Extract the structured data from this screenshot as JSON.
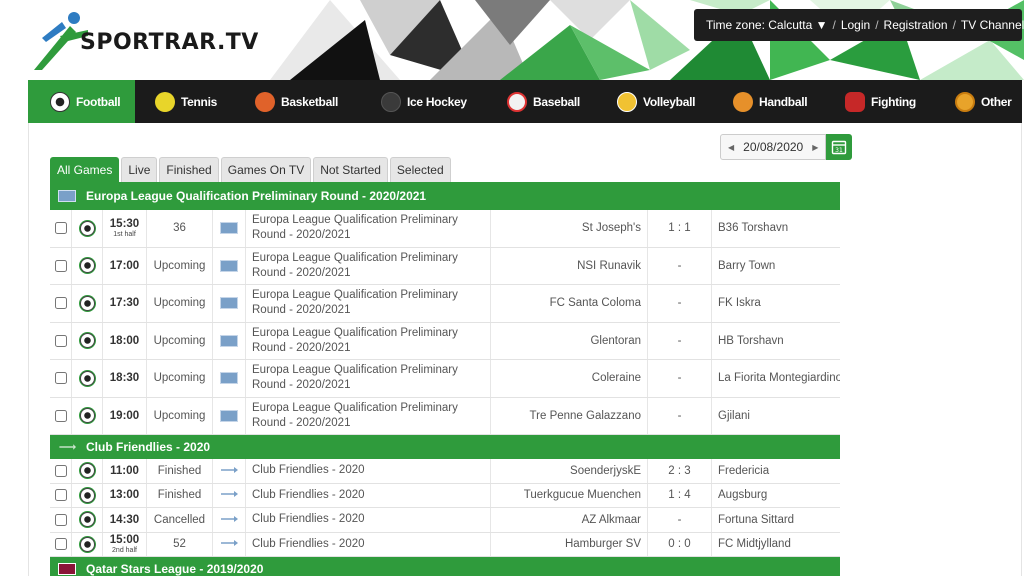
{
  "header": {
    "logo_text": "SPORTRAR.TV",
    "topbar": {
      "timezone_label": "Time zone: Calcutta ▼",
      "sep": "/",
      "login": "Login",
      "registration": "Registration",
      "tv_channels": "TV Channels"
    }
  },
  "nav": {
    "items": [
      {
        "label": "Football",
        "icon": "football-icon",
        "active": true
      },
      {
        "label": "Tennis",
        "icon": "tennis-icon"
      },
      {
        "label": "Basketball",
        "icon": "basketball-icon"
      },
      {
        "label": "Ice Hockey",
        "icon": "ice-hockey-icon"
      },
      {
        "label": "Baseball",
        "icon": "baseball-icon"
      },
      {
        "label": "Volleyball",
        "icon": "volleyball-icon"
      },
      {
        "label": "Handball",
        "icon": "handball-icon"
      },
      {
        "label": "Fighting",
        "icon": "fighting-icon"
      },
      {
        "label": "Other",
        "icon": "other-icon"
      }
    ]
  },
  "date_picker": {
    "value": "20/08/2020",
    "prev": "◀",
    "next": "▶",
    "calendar_label": "31"
  },
  "tabs": [
    {
      "label": "All Games",
      "active": true
    },
    {
      "label": "Live"
    },
    {
      "label": "Finished"
    },
    {
      "label": "Games On TV"
    },
    {
      "label": "Not Started"
    },
    {
      "label": "Selected"
    }
  ],
  "leagues": [
    {
      "title": "Europa League Qualification Preliminary Round - 2020/2021",
      "games": [
        {
          "time": "15:30",
          "half": "1st half",
          "status": "36",
          "league": "Europa League Qualification Preliminary Round - 2020/2021",
          "home": "St Joseph's",
          "score": "1 : 1",
          "away": "B36 Torshavn"
        },
        {
          "time": "17:00",
          "half": "",
          "status": "Upcoming",
          "league": "Europa League Qualification Preliminary Round - 2020/2021",
          "home": "NSI Runavik",
          "score": "-",
          "away": "Barry Town"
        },
        {
          "time": "17:30",
          "half": "",
          "status": "Upcoming",
          "league": "Europa League Qualification Preliminary Round - 2020/2021",
          "home": "FC Santa Coloma",
          "score": "-",
          "away": "FK Iskra"
        },
        {
          "time": "18:00",
          "half": "",
          "status": "Upcoming",
          "league": "Europa League Qualification Preliminary Round - 2020/2021",
          "home": "Glentoran",
          "score": "-",
          "away": "HB Torshavn"
        },
        {
          "time": "18:30",
          "half": "",
          "status": "Upcoming",
          "league": "Europa League Qualification Preliminary Round - 2020/2021",
          "home": "Coleraine",
          "score": "-",
          "away": "La Fiorita Montegiardino"
        },
        {
          "time": "19:00",
          "half": "",
          "status": "Upcoming",
          "league": "Europa League Qualification Preliminary Round - 2020/2021",
          "home": "Tre Penne Galazzano",
          "score": "-",
          "away": "Gjilani"
        }
      ]
    },
    {
      "title": "Club Friendlies - 2020",
      "games": [
        {
          "time": "11:00",
          "half": "",
          "status": "Finished",
          "league": "Club Friendlies - 2020",
          "home": "SoenderjyskE",
          "score": "2 : 3",
          "away": "Fredericia"
        },
        {
          "time": "13:00",
          "half": "",
          "status": "Finished",
          "league": "Club Friendlies - 2020",
          "home": "Tuerkgucue Muenchen",
          "score": "1 : 4",
          "away": "Augsburg"
        },
        {
          "time": "14:30",
          "half": "",
          "status": "Cancelled",
          "league": "Club Friendlies - 2020",
          "home": "AZ Alkmaar",
          "score": "-",
          "away": "Fortuna Sittard"
        },
        {
          "time": "15:00",
          "half": "2nd half",
          "status": "52",
          "league": "Club Friendlies - 2020",
          "home": "Hamburger SV",
          "score": "0 : 0",
          "away": "FC Midtjylland"
        }
      ]
    },
    {
      "title": "Qatar Stars League - 2019/2020",
      "games": []
    }
  ],
  "colors": {
    "accent_green": "#2f9b3c",
    "nav_dark": "#1b1b1b",
    "topbar_dark": "#1e1e1e"
  }
}
